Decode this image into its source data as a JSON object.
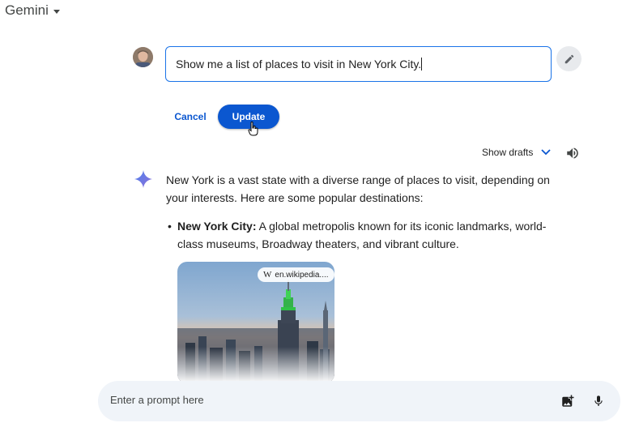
{
  "header": {
    "brand": "Gemini"
  },
  "edit": {
    "value": "Show me a list of places to visit in New York City.",
    "cancel_label": "Cancel",
    "update_label": "Update"
  },
  "drafts": {
    "label": "Show drafts"
  },
  "response": {
    "intro": "New York is a vast state with a diverse range of places to visit, depending on your interests. Here are some popular destinations:",
    "bullets": [
      {
        "title": "New York City:",
        "text": " A global metropolis known for its iconic landmarks, world-class museums, Broadway theaters, and vibrant culture."
      }
    ],
    "image_source": {
      "glyph": "W",
      "label": "en.wikipedia...."
    }
  },
  "prompt": {
    "placeholder": "Enter a prompt here"
  },
  "colors": {
    "accent": "#0b57d0",
    "focus_border": "#1a73e8",
    "prompt_bg": "#f0f4f9"
  }
}
